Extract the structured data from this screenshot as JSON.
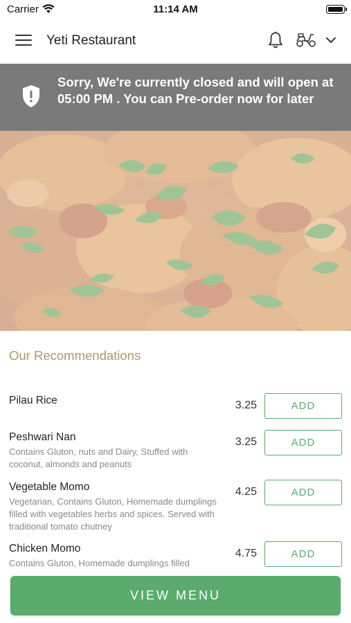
{
  "status_bar": {
    "carrier": "Carrier",
    "time": "11:14 AM"
  },
  "header": {
    "title": "Yeti Restaurant"
  },
  "banner": {
    "text": "Sorry, We're currently closed and will open at 05:00 PM . You can Pre-order now for later"
  },
  "recommendations": {
    "title": "Our Recommendations",
    "add_label": "ADD",
    "items": [
      {
        "name": "Pilau Rice",
        "description": "",
        "price": "3.25"
      },
      {
        "name": "Peshwari Nan",
        "description": "Contains Gluton, nuts and Dairy, Stuffed with coconut, almonds and peanuts",
        "price": "3.25"
      },
      {
        "name": "Vegetable Momo",
        "description": "Vegetarian, Contains Gluton, Homemade dumplings filled with vegetables herbs and spices. Served with traditional tomato chutney",
        "price": "4.25"
      },
      {
        "name": "Chicken Momo",
        "description": "Contains Gluton, Homemade dumplings filled",
        "price": "4.75"
      }
    ]
  },
  "view_menu_label": "VIEW MENU",
  "icons": {
    "menu": "hamburger-menu-icon",
    "notifications": "bell-icon",
    "delivery": "scooter-icon",
    "dropdown": "chevron-down-icon",
    "closed_notice": "shield-alert-icon"
  },
  "colors": {
    "accent": "#5aab6d",
    "banner": "#7a7a7a",
    "section_title": "#a89a6e"
  }
}
